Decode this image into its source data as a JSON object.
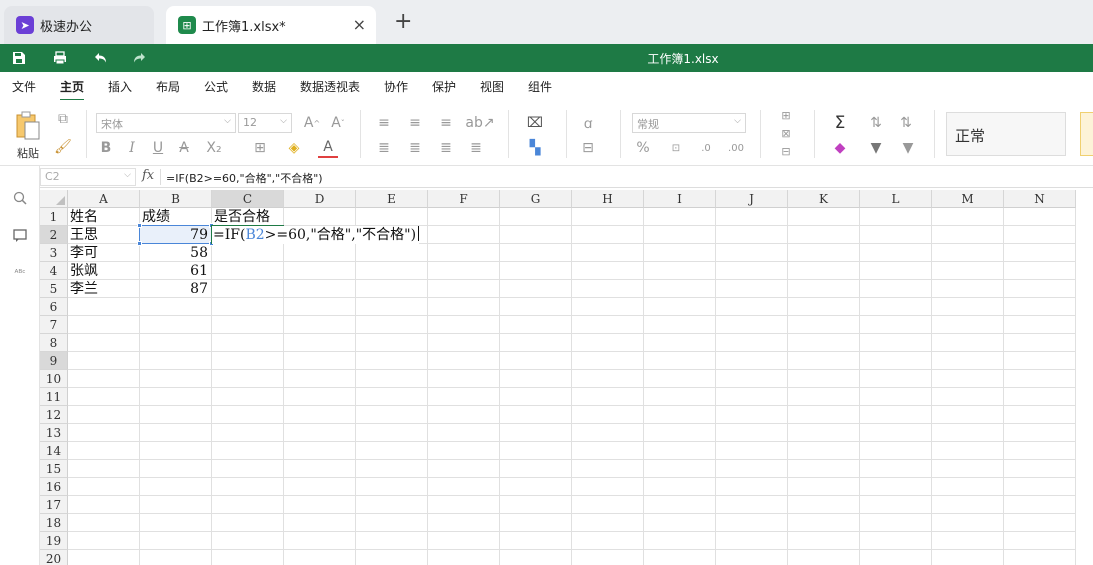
{
  "tabs": [
    {
      "label": "极速办公",
      "close": ""
    },
    {
      "label": "工作簿1.xlsx*",
      "close": "×"
    }
  ],
  "new_tab_symbol": "+",
  "title": "工作簿1.xlsx",
  "menu": [
    "文件",
    "主页",
    "插入",
    "布局",
    "公式",
    "数据",
    "数据透视表",
    "协作",
    "保护",
    "视图",
    "组件"
  ],
  "menu_active": "主页",
  "ribbon": {
    "paste_label": "粘贴",
    "font_name": "宋体",
    "font_size": "12",
    "number_format": "常规",
    "cell_style": "正常"
  },
  "formula_bar": {
    "name_box": "C2",
    "fx_label": "fx",
    "formula": "=IF(B2>=60,\"合格\",\"不合格\")"
  },
  "columns": [
    "A",
    "B",
    "C",
    "D",
    "E",
    "F",
    "G",
    "H",
    "I",
    "J",
    "K",
    "L",
    "M",
    "N"
  ],
  "rows": [
    "1",
    "2",
    "3",
    "4",
    "5",
    "6",
    "7",
    "8",
    "9",
    "10",
    "11",
    "12",
    "13",
    "14",
    "15",
    "16",
    "17",
    "18",
    "19",
    "20"
  ],
  "cells": {
    "A1": "姓名",
    "B1": "成绩",
    "C1": "是否合格",
    "A2": "王思",
    "B2": "79",
    "A3": "李可",
    "B3": "58",
    "A4": "张飒",
    "B4": "61",
    "A5": "李兰",
    "B5": "87"
  },
  "editor": {
    "prefix": "=IF(",
    "ref": "B2",
    "suffix": ">=60,\"合格\",\"不合格\")"
  },
  "colors": {
    "brand_green": "#1e7a45",
    "selection_blue": "#4a86d8"
  }
}
